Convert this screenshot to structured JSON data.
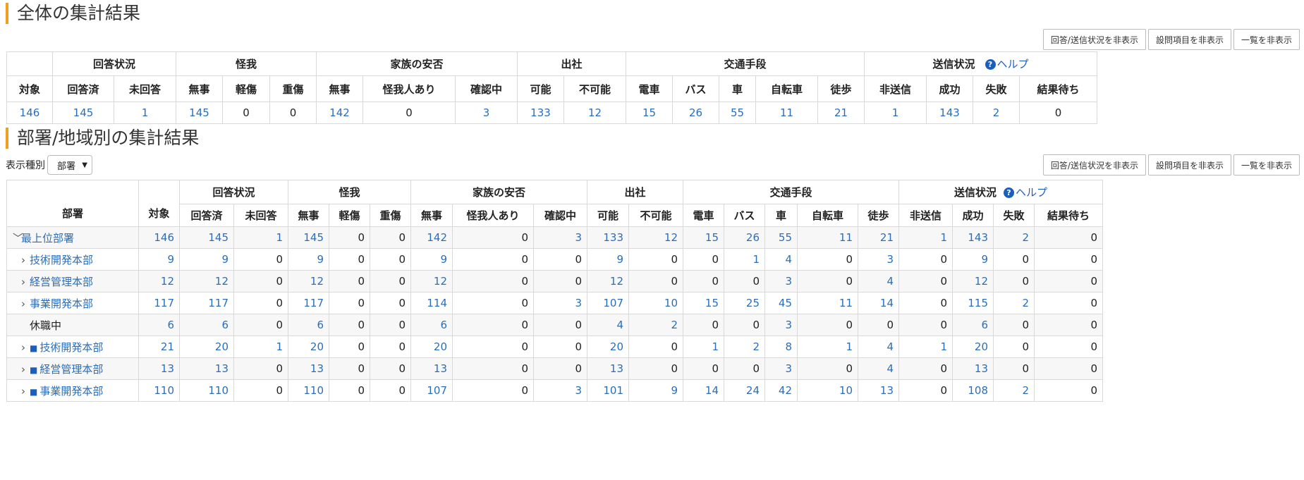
{
  "overall": {
    "title": "全体の集計結果",
    "buttons": [
      "回答/送信状況を非表示",
      "設問項目を非表示",
      "一覧を非表示"
    ],
    "groups": {
      "answer": "回答状況",
      "injury": "怪我",
      "family": "家族の安否",
      "attend": "出社",
      "transport": "交通手段",
      "send": "送信状況"
    },
    "help": "ヘルプ",
    "columns": [
      "対象",
      "回答済",
      "未回答",
      "無事",
      "軽傷",
      "重傷",
      "無事",
      "怪我人あり",
      "確認中",
      "可能",
      "不可能",
      "電車",
      "バス",
      "車",
      "自転車",
      "徒歩",
      "非送信",
      "成功",
      "失敗",
      "結果待ち"
    ],
    "values": [
      "146",
      "145",
      "1",
      "145",
      "0",
      "0",
      "142",
      "0",
      "3",
      "133",
      "12",
      "15",
      "26",
      "55",
      "11",
      "21",
      "1",
      "143",
      "2",
      "0"
    ]
  },
  "by_dept": {
    "title": "部署/地域別の集計結果",
    "display_label": "表示種別",
    "display_value": "部署",
    "buttons": [
      "回答/送信状況を非表示",
      "設問項目を非表示",
      "一覧を非表示"
    ],
    "dept_header": "部署",
    "rows": [
      {
        "indent": 0,
        "chevron": "﹀",
        "mark": "",
        "name": "最上位部署",
        "link": true,
        "values": [
          "146",
          "145",
          "1",
          "145",
          "0",
          "0",
          "142",
          "0",
          "3",
          "133",
          "12",
          "15",
          "26",
          "55",
          "11",
          "21",
          "1",
          "143",
          "2",
          "0"
        ]
      },
      {
        "indent": 1,
        "chevron": "›",
        "mark": "",
        "name": "技術開発本部",
        "link": true,
        "values": [
          "9",
          "9",
          "0",
          "9",
          "0",
          "0",
          "9",
          "0",
          "0",
          "9",
          "0",
          "0",
          "1",
          "4",
          "0",
          "3",
          "0",
          "9",
          "0",
          "0"
        ]
      },
      {
        "indent": 1,
        "chevron": "›",
        "mark": "",
        "name": "経営管理本部",
        "link": true,
        "values": [
          "12",
          "12",
          "0",
          "12",
          "0",
          "0",
          "12",
          "0",
          "0",
          "12",
          "0",
          "0",
          "0",
          "3",
          "0",
          "4",
          "0",
          "12",
          "0",
          "0"
        ]
      },
      {
        "indent": 1,
        "chevron": "›",
        "mark": "",
        "name": "事業開発本部",
        "link": true,
        "values": [
          "117",
          "117",
          "0",
          "117",
          "0",
          "0",
          "114",
          "0",
          "3",
          "107",
          "10",
          "15",
          "25",
          "45",
          "11",
          "14",
          "0",
          "115",
          "2",
          "0"
        ]
      },
      {
        "indent": 1,
        "chevron": "",
        "mark": "",
        "name": "休職中",
        "link": false,
        "values": [
          "6",
          "6",
          "0",
          "6",
          "0",
          "0",
          "6",
          "0",
          "0",
          "4",
          "2",
          "0",
          "0",
          "3",
          "0",
          "0",
          "0",
          "6",
          "0",
          "0"
        ]
      },
      {
        "indent": 1,
        "chevron": "›",
        "mark": "■",
        "name": "技術開発本部",
        "link": true,
        "values": [
          "21",
          "20",
          "1",
          "20",
          "0",
          "0",
          "20",
          "0",
          "0",
          "20",
          "0",
          "1",
          "2",
          "8",
          "1",
          "4",
          "1",
          "20",
          "0",
          "0"
        ]
      },
      {
        "indent": 1,
        "chevron": "›",
        "mark": "■",
        "name": "経営管理本部",
        "link": true,
        "values": [
          "13",
          "13",
          "0",
          "13",
          "0",
          "0",
          "13",
          "0",
          "0",
          "13",
          "0",
          "0",
          "0",
          "3",
          "0",
          "4",
          "0",
          "13",
          "0",
          "0"
        ]
      },
      {
        "indent": 1,
        "chevron": "›",
        "mark": "■",
        "name": "事業開発本部",
        "link": true,
        "values": [
          "110",
          "110",
          "0",
          "110",
          "0",
          "0",
          "107",
          "0",
          "3",
          "101",
          "9",
          "14",
          "24",
          "42",
          "10",
          "13",
          "0",
          "108",
          "2",
          "0"
        ]
      }
    ]
  }
}
